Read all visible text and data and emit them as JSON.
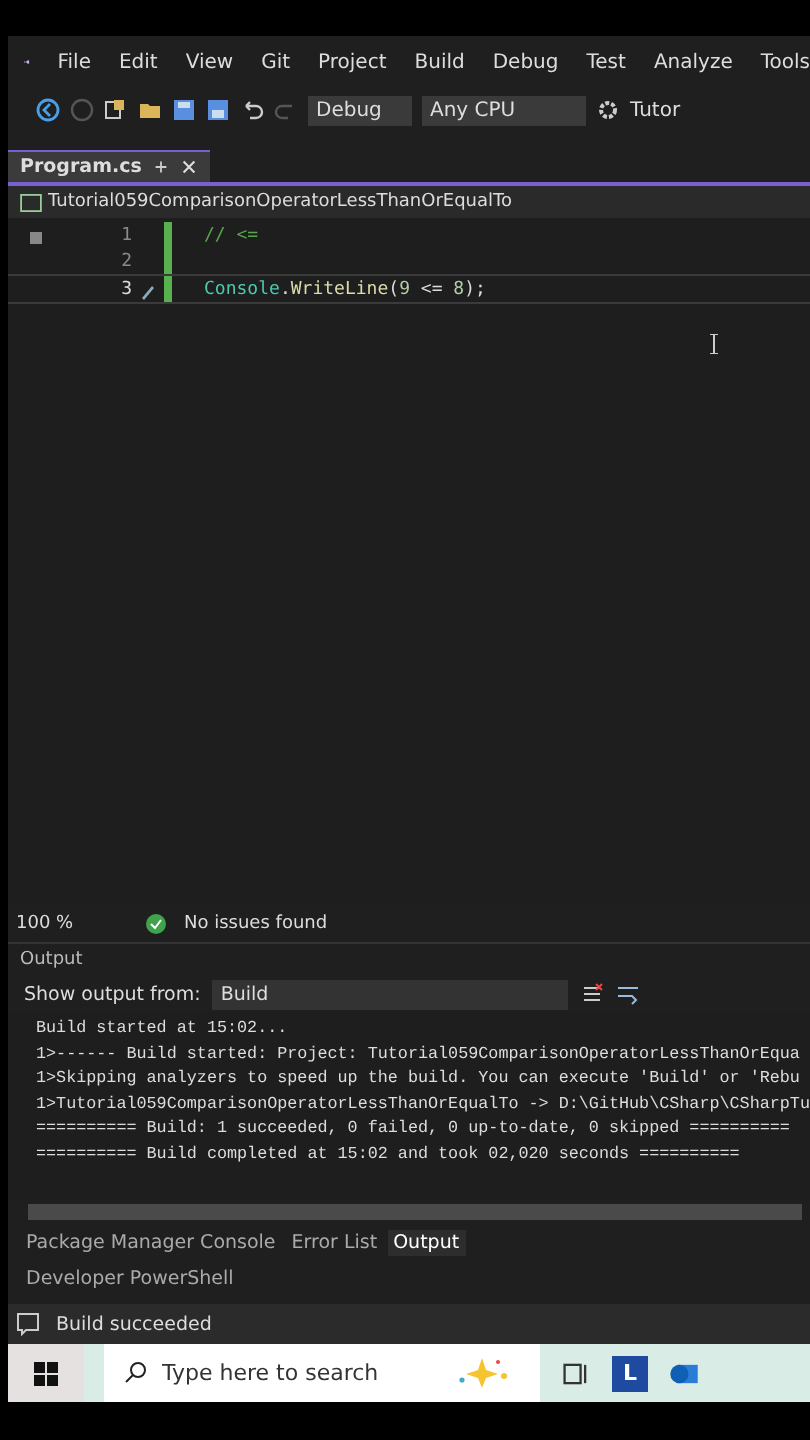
{
  "menu": [
    "File",
    "Edit",
    "View",
    "Git",
    "Project",
    "Build",
    "Debug",
    "Test",
    "Analyze",
    "Tools"
  ],
  "toolbar": {
    "configuration": "Debug",
    "platform": "Any CPU",
    "start": "Tutor"
  },
  "tabs": [
    {
      "label": "Program.cs",
      "selected": true
    }
  ],
  "nav_bar": {
    "project": "Tutorial059ComparisonOperatorLessThanOrEqualTo"
  },
  "editor": {
    "lines": [
      {
        "number": "1",
        "current": false,
        "tokens": [
          {
            "text": "// <=",
            "kind": "comment"
          }
        ]
      },
      {
        "number": "2",
        "current": false
      },
      {
        "number": "3",
        "current": true,
        "tokens": [
          {
            "text": "Console",
            "kind": "type"
          },
          {
            "text": ".",
            "kind": "plain"
          },
          {
            "text": "WriteLine",
            "kind": "method"
          },
          {
            "text": "(",
            "kind": "plain"
          },
          {
            "text": "9",
            "kind": "number"
          },
          {
            "text": " <= ",
            "kind": "plain"
          },
          {
            "text": "8",
            "kind": "number"
          },
          {
            "text": ");",
            "kind": "plain"
          }
        ]
      }
    ]
  },
  "editor_status": {
    "zoom": "100 %",
    "issues": "No issues found"
  },
  "output": {
    "title": "Output",
    "source_label": "Show output from:",
    "source": "Build",
    "lines": [
      "Build started at 15:02...",
      "1>------ Build started: Project: Tutorial059ComparisonOperatorLessThanOrEqua",
      "1>Skipping analyzers to speed up the build. You can execute 'Build' or 'Rebu",
      "1>Tutorial059ComparisonOperatorLessThanOrEqualTo -> D:\\GitHub\\CSharp\\CSharpTu",
      "========== Build: 1 succeeded, 0 failed, 0 up-to-date, 0 skipped ==========",
      "========== Build completed at 15:02 and took 02,020 seconds =========="
    ]
  },
  "bottom_tabs": [
    {
      "label": "Package Manager Console",
      "selected": false
    },
    {
      "label": "Error List",
      "selected": false
    },
    {
      "label": "Output",
      "selected": true
    }
  ],
  "bottom_tabs_2": [
    {
      "label": "Developer PowerShell",
      "selected": false
    }
  ],
  "status_bar": {
    "message": "Build succeeded"
  },
  "taskbar": {
    "search": {
      "placeholder": "Type here to search"
    },
    "app_letter": "L"
  }
}
